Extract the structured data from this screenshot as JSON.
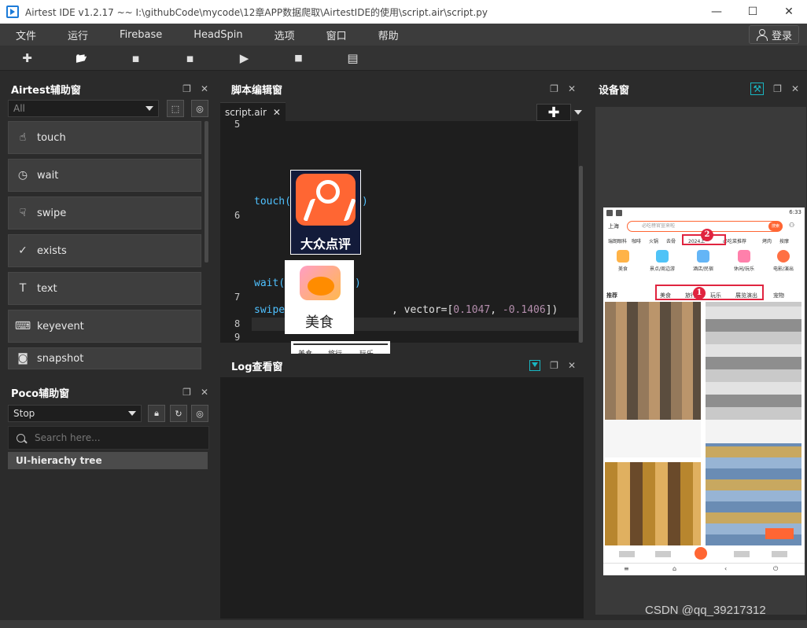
{
  "window": {
    "title": "Airtest IDE v1.2.17 ~~ I:\\githubCode\\mycode\\12章APP数据爬取\\AirtestIDE的使用\\script.air\\script.py",
    "minimize": "—",
    "maximize": "☐",
    "close": "✕"
  },
  "menu": {
    "items": [
      "文件",
      "运行",
      "Firebase",
      "HeadSpin",
      "选项",
      "窗口",
      "帮助"
    ],
    "login": "登录"
  },
  "toolbar": {
    "icons": [
      "new-icon",
      "open-folder-icon",
      "save-icon",
      "save-as-icon",
      "run-icon",
      "stop-icon",
      "log-list-icon"
    ],
    "glyphs": [
      "✚",
      "📂",
      "▪",
      "▪",
      "▶",
      "■",
      "▤"
    ]
  },
  "airtest_panel": {
    "title": "Airtest辅助窗",
    "filter_value": "All",
    "commands": [
      {
        "label": "touch",
        "icon": "hand-pointer-icon",
        "glyph": "☝"
      },
      {
        "label": "wait",
        "icon": "clock-icon",
        "glyph": "◷"
      },
      {
        "label": "swipe",
        "icon": "swipe-hand-icon",
        "glyph": "☟"
      },
      {
        "label": "exists",
        "icon": "check-circle-icon",
        "glyph": "✓"
      },
      {
        "label": "text",
        "icon": "text-box-icon",
        "glyph": "T"
      },
      {
        "label": "keyevent",
        "icon": "keyboard-icon",
        "glyph": "⌨"
      },
      {
        "label": "snapshot",
        "icon": "camera-icon",
        "glyph": "◙"
      }
    ]
  },
  "poco_panel": {
    "title": "Poco辅助窗",
    "mode_value": "Stop",
    "search_placeholder": "Search here...",
    "tree_root": "UI-hierachy tree"
  },
  "editor": {
    "title": "脚本编辑窗",
    "tab_label": "script.air",
    "tab_close": "✕",
    "add_glyph": "✚",
    "lines": {
      "n5": "5",
      "n6": "6",
      "n7": "7",
      "n8": "8",
      "n9": "9",
      "touch_fn": "touch(",
      "touch_close": ")",
      "wait_fn": "wait(",
      "wait_close": ")",
      "swipe_fn": "swipe(",
      "swipe_rest": ", vector=[",
      "vec_x": "0.1047",
      "vec_sep": ", ",
      "vec_y": "-0.1406",
      "swipe_end": "])"
    },
    "images": {
      "touch_label": "大众点评",
      "wait_label": "美食",
      "swipe_labels": [
        "美食",
        "旅行",
        "玩乐"
      ]
    }
  },
  "log_panel": {
    "title": "Log查看窗"
  },
  "device_panel": {
    "title": "设备窗",
    "phone": {
      "time": "6:33",
      "city": "上海",
      "search_hint": "必吃榜官宣来啦",
      "search_btn": "搜索",
      "chips": [
        "瑞朗眼科",
        "咖啡",
        "火锅",
        "去骨",
        "2024上",
        "必吃菜推荐",
        "烤肉",
        "按摩"
      ],
      "cats": [
        "美食",
        "景点/周边游",
        "酒店/民宿",
        "休闲/玩乐",
        "电影/演出"
      ],
      "tabs": [
        "推荐",
        "美食",
        "旅行",
        "玩乐",
        "展览演出",
        "宠物"
      ],
      "sysnav": [
        "≡",
        "⌂",
        "‹",
        "⏻"
      ]
    },
    "annotations": [
      "1",
      "2"
    ]
  },
  "watermark": "CSDN @qq_39217312"
}
